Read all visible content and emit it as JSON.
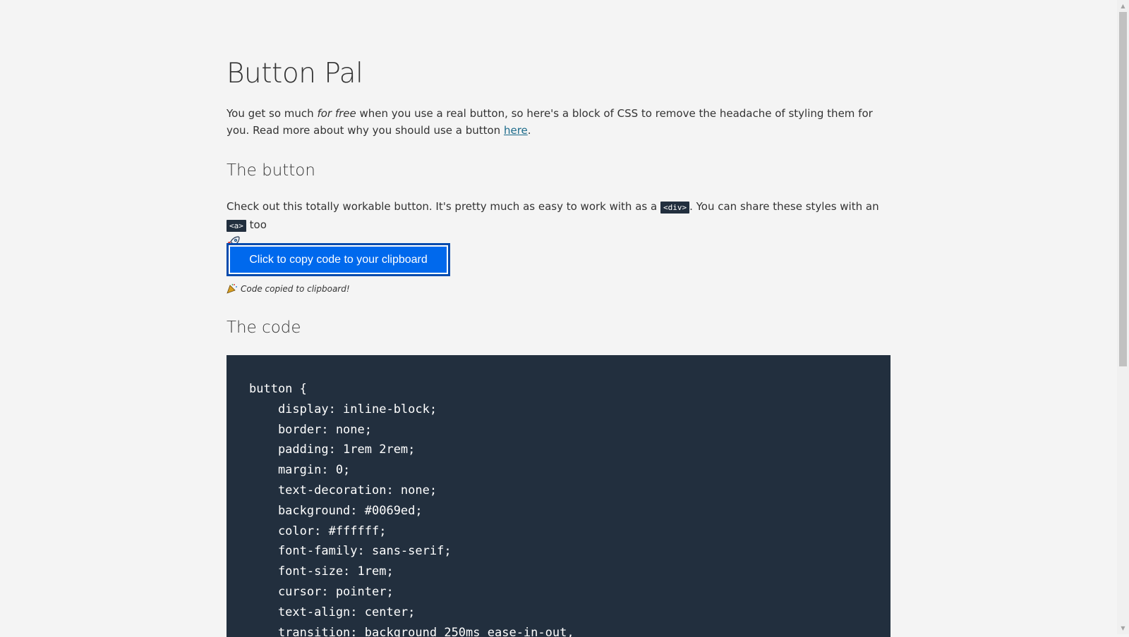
{
  "header": {
    "title": "Button Pal"
  },
  "intro": {
    "text_before": "You get so much ",
    "emphasis": "for free",
    "text_after": " when you use a real button, so here's a block of CSS to remove the headache of styling them for you. Read more about why you should use a button ",
    "link_label": "here",
    "end": "."
  },
  "section_button": {
    "heading": "The button",
    "desc_before": "Check out this totally workable button. It's pretty much as easy to work with as a ",
    "code_div": "<div>",
    "desc_middle": ". You can share these styles with an ",
    "code_a": "<a>",
    "desc_after": " too ",
    "rocket_icon": "rocket-icon",
    "button_label": "Click to copy code to your clipboard",
    "copied_message": "Code copied to clipboard!",
    "party_icon": "party-popper-icon"
  },
  "section_code": {
    "heading": "The code",
    "lines": [
      "button {",
      "    display: inline-block;",
      "    border: none;",
      "    padding: 1rem 2rem;",
      "    margin: 0;",
      "    text-decoration: none;",
      "    background: #0069ed;",
      "    color: #ffffff;",
      "    font-family: sans-serif;",
      "    font-size: 1rem;",
      "    cursor: pointer;",
      "    text-align: center;",
      "    transition: background 250ms ease-in-out,"
    ]
  },
  "colors": {
    "button_bg": "#0069ed",
    "code_bg": "#222f3e",
    "page_bg": "#f4f4f4",
    "link": "#1b6a8a"
  }
}
